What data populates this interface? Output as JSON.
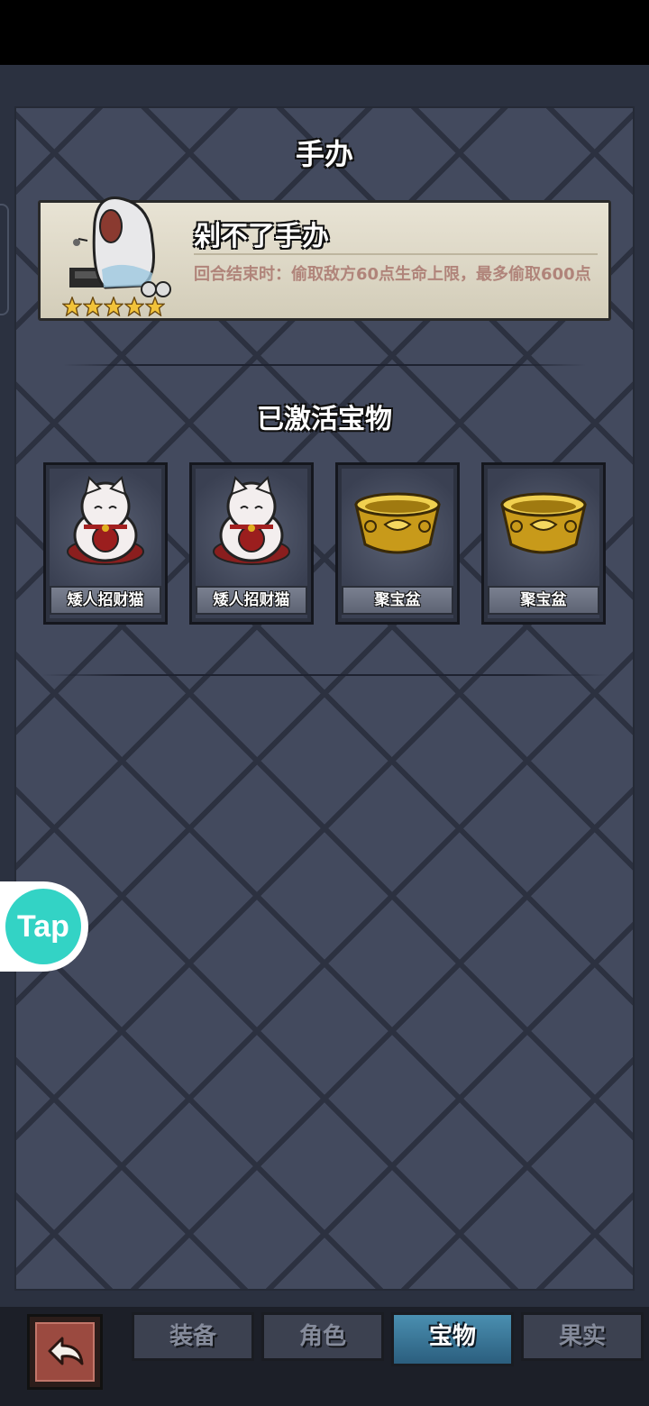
{
  "header": {
    "title": "手办"
  },
  "figure_card": {
    "name": "剁不了手办",
    "description": "回合结束时：偷取敌方60点生命上限，最多偷取600点",
    "stars": 5
  },
  "treasures": {
    "title": "已激活宝物",
    "items": [
      {
        "label": "矮人招财猫",
        "icon": "lucky-cat-icon"
      },
      {
        "label": "矮人招财猫",
        "icon": "lucky-cat-icon"
      },
      {
        "label": "聚宝盆",
        "icon": "treasure-bowl-icon"
      },
      {
        "label": "聚宝盆",
        "icon": "treasure-bowl-icon"
      }
    ]
  },
  "floating": {
    "tap_label": "Tap"
  },
  "tabs": [
    {
      "label": "装备",
      "active": false
    },
    {
      "label": "角色",
      "active": false
    },
    {
      "label": "宝物",
      "active": true
    },
    {
      "label": "果实",
      "active": false
    }
  ],
  "colors": {
    "active_tab": "#3a7ea0",
    "card_bg": "#e3ddcc",
    "tap_brand": "#33d3c5"
  }
}
